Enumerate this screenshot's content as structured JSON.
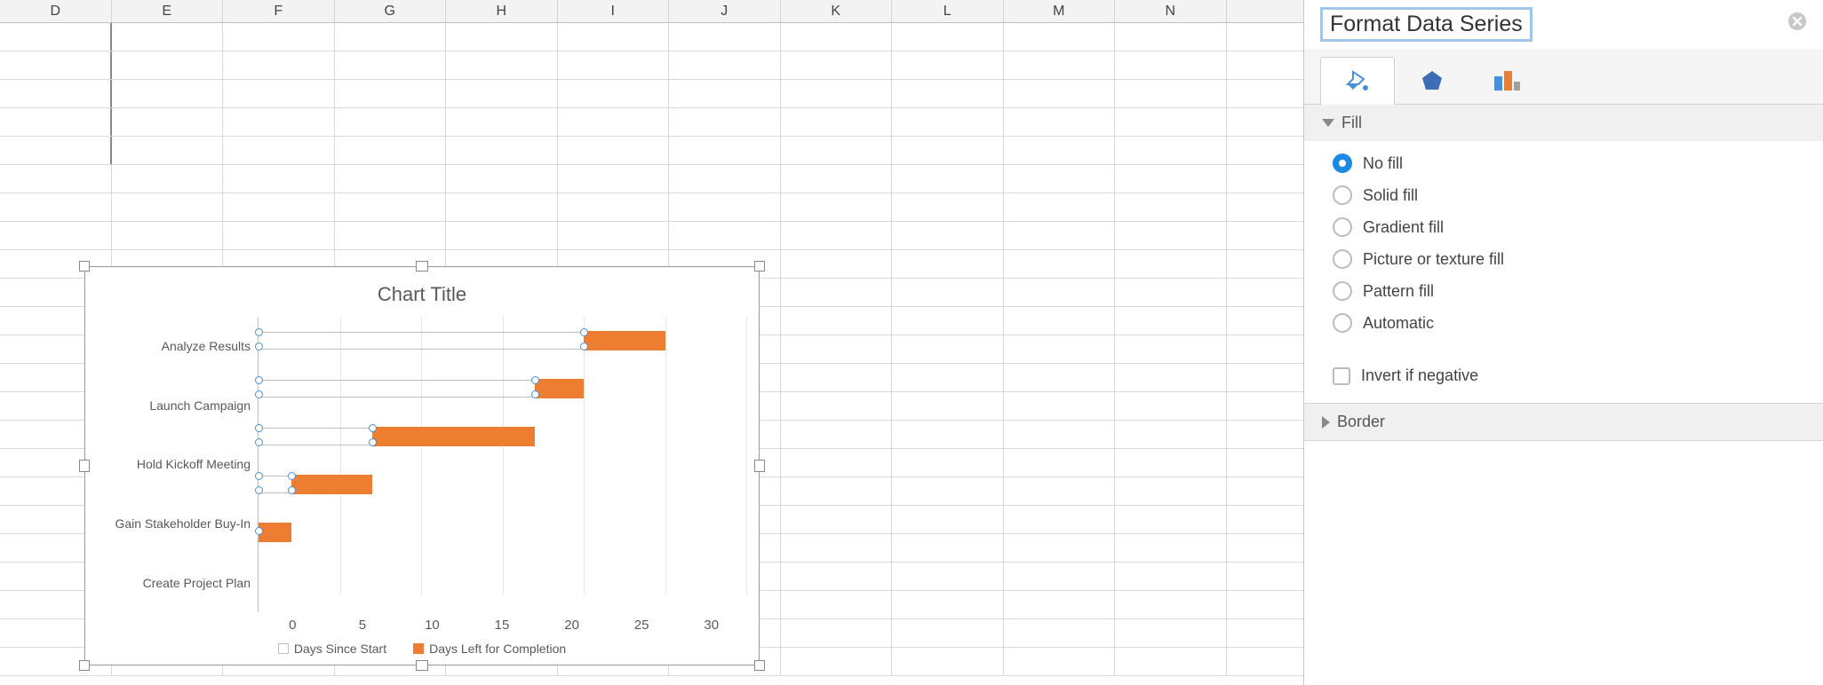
{
  "columns": [
    "D",
    "E",
    "F",
    "G",
    "H",
    "I",
    "J",
    "K",
    "L",
    "M",
    "N"
  ],
  "panel": {
    "title": "Format Data Series",
    "fill_section": "Fill",
    "border_section": "Border",
    "options": {
      "no_fill": "No fill",
      "solid": "Solid fill",
      "gradient": "Gradient fill",
      "picture": "Picture or texture fill",
      "pattern": "Pattern fill",
      "auto": "Automatic",
      "invert": "Invert if negative"
    },
    "selected_fill": "no_fill"
  },
  "chart_data": {
    "type": "bar",
    "title": "Chart Title",
    "xlabel": "",
    "ylabel": "",
    "xlim": [
      0,
      30
    ],
    "x_ticks": [
      0,
      5,
      10,
      15,
      20,
      25,
      30
    ],
    "categories": [
      "Analyze Results",
      "Launch Campaign",
      "Hold Kickoff Meeting",
      "Gain Stakeholder Buy-In",
      "Create Project Plan"
    ],
    "series": [
      {
        "name": "Days Since Start",
        "values": [
          20,
          17,
          7,
          2,
          0
        ],
        "selected": true
      },
      {
        "name": "Days Left for Completion",
        "values": [
          5,
          3,
          10,
          5,
          2
        ]
      }
    ],
    "legend_position": "bottom",
    "grid": true,
    "colors": {
      "s1": "transparent",
      "s2": "#ed7d31"
    }
  }
}
